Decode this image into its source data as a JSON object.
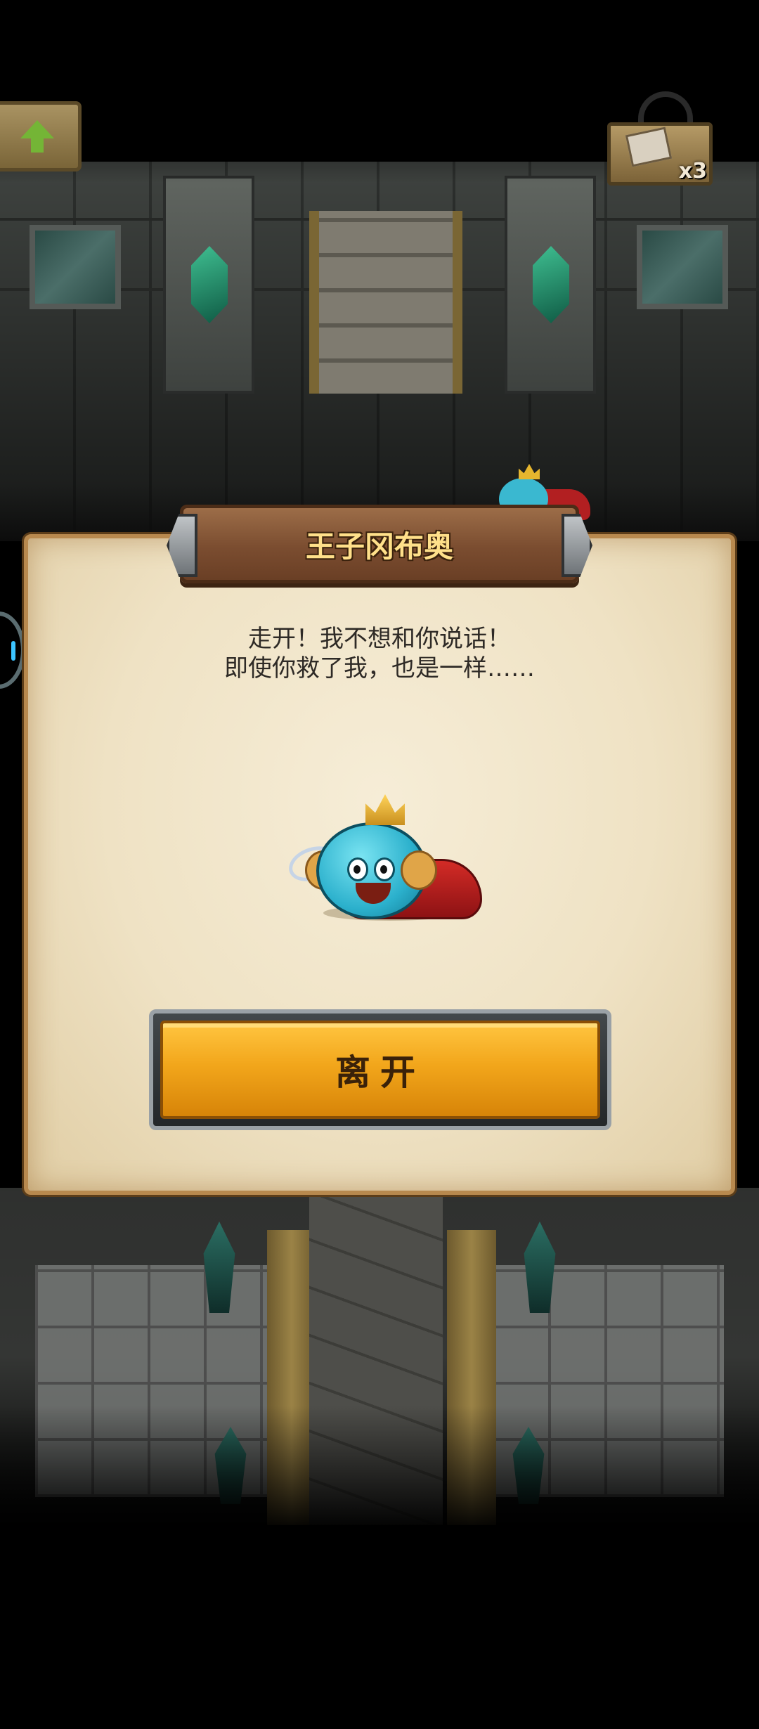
{
  "hud": {
    "back_icon": "up-arrow-icon",
    "inventory_icon": "bag-icon",
    "inventory_count": "x3"
  },
  "dialog": {
    "title": "王子冈布奥",
    "lines": [
      "走开！我不想和你说话！",
      "即使你救了我，也是一样……"
    ],
    "character_icon": "prince-slime-icon",
    "leave_button_label": "离开"
  },
  "colors": {
    "parchment": "#efe2c4",
    "title_text": "#ffe08a",
    "button_gold": "#f2a61b",
    "plank_brown": "#7b4d30"
  }
}
